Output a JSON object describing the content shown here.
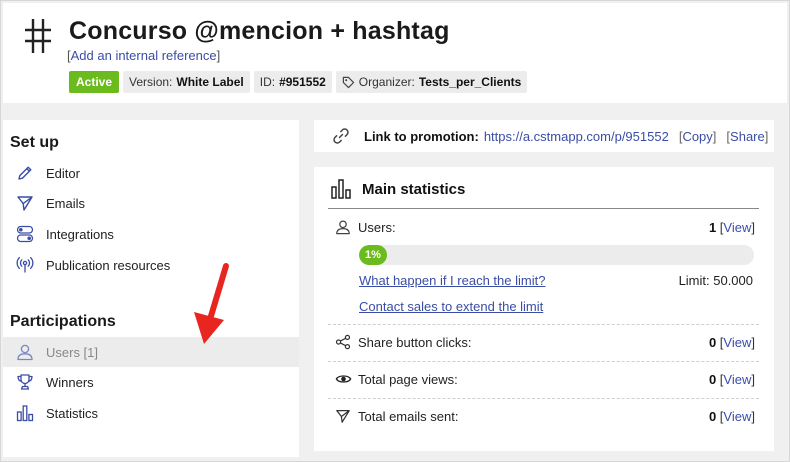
{
  "header": {
    "title": "Concurso @mencion + hashtag",
    "ref_open": "[",
    "ref_link": "Add an internal reference",
    "ref_close": "]",
    "badges": {
      "status": "Active",
      "version_label": "Version:",
      "version_value": "White Label",
      "id_label": "ID:",
      "id_value": "#951552",
      "organizer_label": "Organizer:",
      "organizer_value": "Tests_per_Clients"
    }
  },
  "sidebar": {
    "setup_heading": "Set up",
    "setup_items": [
      {
        "label": "Editor",
        "icon": "pencil-icon"
      },
      {
        "label": "Emails",
        "icon": "send-icon"
      },
      {
        "label": "Integrations",
        "icon": "toggle-icon"
      },
      {
        "label": "Publication resources",
        "icon": "broadcast-icon"
      }
    ],
    "participations_heading": "Participations",
    "participation_items": [
      {
        "label": "Users [1]",
        "icon": "user-icon",
        "selected": true
      },
      {
        "label": "Winners",
        "icon": "trophy-icon"
      },
      {
        "label": "Statistics",
        "icon": "bar-chart-icon"
      }
    ]
  },
  "linkbar": {
    "label": "Link to promotion:",
    "url": "https://a.cstmapp.com/p/951552",
    "copy": "Copy",
    "share": "Share"
  },
  "stats": {
    "title": "Main statistics",
    "users": {
      "label": "Users:",
      "value": "1",
      "view": "View"
    },
    "progress": {
      "percent": 1,
      "text": "1%"
    },
    "limit_question": "What happen if I reach the limit?",
    "limit_text": "Limit: 50.000",
    "contact_sales": "Contact sales to extend the limit",
    "share_clicks": {
      "label": "Share button clicks:",
      "value": "0",
      "view": "View"
    },
    "page_views": {
      "label": "Total page views:",
      "value": "0",
      "view": "View"
    },
    "emails_sent": {
      "label": "Total emails sent:",
      "value": "0",
      "view": "View"
    }
  },
  "colors": {
    "accent_green": "#6cbb1e",
    "link_blue": "#3a4da6",
    "annotation_red": "#e8261f"
  }
}
